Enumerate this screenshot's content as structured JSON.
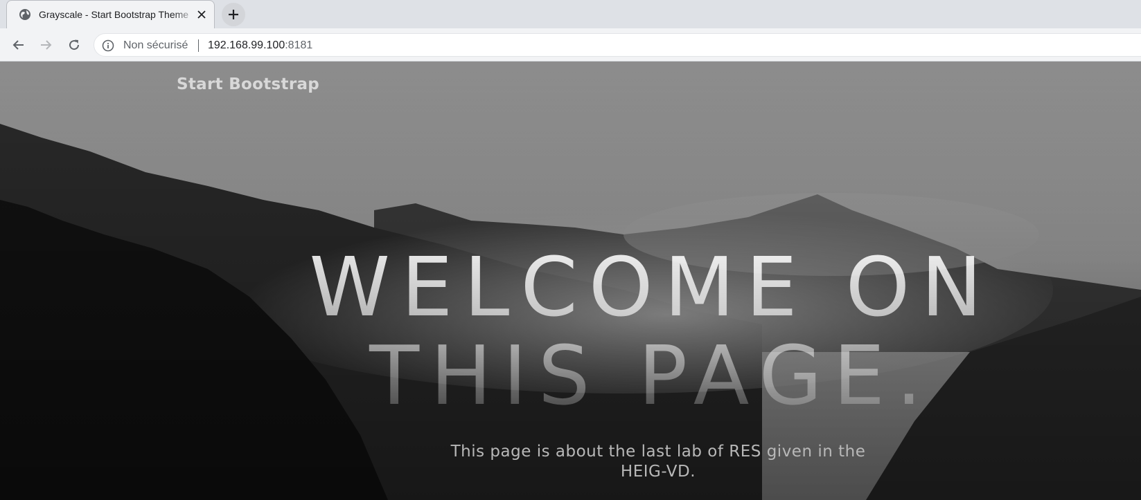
{
  "browser": {
    "tab": {
      "title": "Grayscale - Start Bootstrap Theme",
      "favicon": "globe-icon"
    },
    "security_label": "Non sécurisé",
    "url_host": "192.168.99.100",
    "url_port": ":8181"
  },
  "page": {
    "brand": "Start Bootstrap",
    "headline": {
      "line1": "WELCOME ON",
      "line2": "THIS PAGE."
    },
    "intro": "This page is about the last lab of RES given in the HEIG-VD."
  },
  "colors": {
    "chrome_bg": "#dee1e6",
    "toolbar_bg": "#f2f3f5",
    "brand_text": "#d8d8d8",
    "intro_text": "#b8b8b8"
  }
}
